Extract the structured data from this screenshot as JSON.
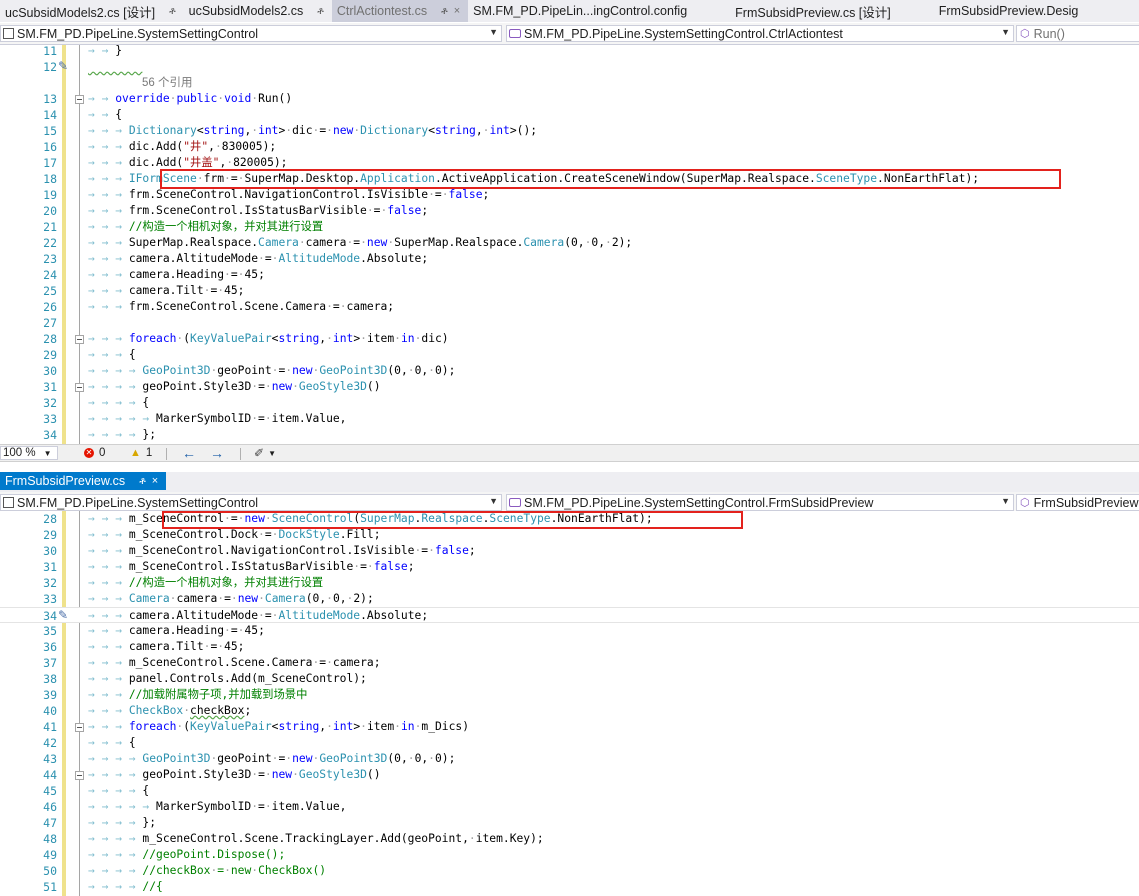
{
  "top_tabs": [
    {
      "label": "ucSubsidModels2.cs [设计]",
      "pin": "ቶ"
    },
    {
      "label": "ucSubsidModels2.cs",
      "pin": "ቶ"
    },
    {
      "label": "CtrlActiontest.cs",
      "pin": "ቶ",
      "close": "×"
    },
    {
      "label": "SM.FM_PD.PipeLin...ingControl.config"
    },
    {
      "label": "FrmSubsidPreview.cs [设计]"
    },
    {
      "label": "FrmSubsidPreview.Desig"
    }
  ],
  "top_nav": {
    "project": "SM.FM_PD.PipeLine.SystemSettingControl",
    "class": "SM.FM_PD.PipeLine.SystemSettingControl.CtrlActiontest",
    "member": "Run()"
  },
  "top_codelens": "56 个引用",
  "top_line_numbers": [
    "11",
    "12",
    "",
    "13",
    "14",
    "15",
    "16",
    "17",
    "18",
    "19",
    "20",
    "21",
    "22",
    "23",
    "24",
    "25",
    "26",
    "27",
    "28",
    "29",
    "30",
    "31",
    "32",
    "33",
    "34"
  ],
  "status": {
    "zoom": "100 %",
    "errors": "0",
    "warnings": "1"
  },
  "bottom_tabs": [
    {
      "label": "FrmSubsidPreview.cs",
      "pin": "ቶ",
      "close": "×"
    }
  ],
  "bottom_nav": {
    "project": "SM.FM_PD.PipeLine.SystemSettingControl",
    "class": "SM.FM_PD.PipeLine.SystemSettingControl.FrmSubsidPreview",
    "member": "FrmSubsidPreview"
  },
  "bottom_line_numbers": [
    "28",
    "29",
    "30",
    "31",
    "32",
    "33",
    "34",
    "35",
    "36",
    "37",
    "38",
    "39",
    "40",
    "41",
    "42",
    "43",
    "44",
    "45",
    "46",
    "47",
    "48",
    "49",
    "50",
    "51"
  ],
  "colors": {
    "active_tab": "#007acc",
    "highlight_box": "#e3221d",
    "keyword": "#0000ff",
    "type": "#2b91af",
    "string": "#a31515",
    "comment": "#008000"
  }
}
